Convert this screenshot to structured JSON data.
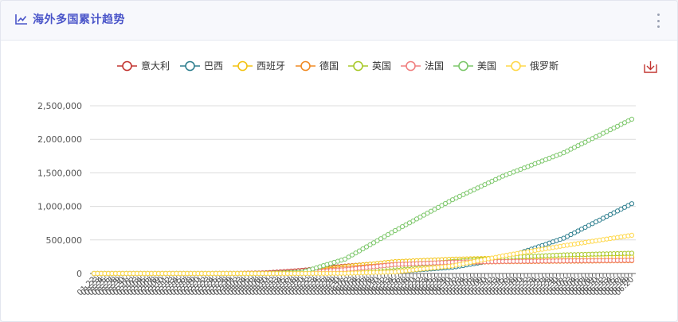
{
  "header": {
    "title": "海外多国累计趋势",
    "title_icon": "line-chart-icon",
    "menu_icon": "more-vertical-icon"
  },
  "toolbar": {
    "download_icon": "download-icon",
    "download_color": "#c23531"
  },
  "chart_data": {
    "type": "line",
    "title": "",
    "xlabel": "",
    "ylabel": "",
    "ylim": [
      0,
      2500000
    ],
    "yticks": [
      0,
      500000,
      1000000,
      1500000,
      2000000,
      2500000
    ],
    "ytick_labels": [
      "0",
      "500,000",
      "1,000,000",
      "1,500,000",
      "2,000,000",
      "2,500,000"
    ],
    "grid": true,
    "legend_position": "top",
    "marker": "hollow-circle",
    "x_start": "2020-01-22",
    "x_end": "2020-06-20",
    "x_tick_format": "MM.DD",
    "series": [
      {
        "name": "意大利",
        "color": "#c23531",
        "x": [
          "2020-01-22",
          "2020-02-21",
          "2020-03-01",
          "2020-03-10",
          "2020-03-20",
          "2020-04-01",
          "2020-04-15",
          "2020-05-01",
          "2020-05-15",
          "2020-06-01",
          "2020-06-20"
        ],
        "y": [
          0,
          20,
          1700,
          10100,
          47000,
          110000,
          165000,
          207000,
          224000,
          233000,
          238000
        ]
      },
      {
        "name": "巴西",
        "color": "#2f7f8f",
        "x": [
          "2020-01-22",
          "2020-03-01",
          "2020-03-20",
          "2020-04-01",
          "2020-04-15",
          "2020-05-01",
          "2020-05-15",
          "2020-06-01",
          "2020-06-20"
        ],
        "y": [
          0,
          2,
          900,
          6800,
          28000,
          92000,
          218000,
          526000,
          1040000
        ]
      },
      {
        "name": "西班牙",
        "color": "#f3c314",
        "x": [
          "2020-01-22",
          "2020-03-01",
          "2020-03-10",
          "2020-03-20",
          "2020-04-01",
          "2020-04-15",
          "2020-05-01",
          "2020-05-15",
          "2020-06-01",
          "2020-06-20"
        ],
        "y": [
          0,
          80,
          1700,
          21000,
          102000,
          177000,
          213000,
          230000,
          240000,
          246000
        ]
      },
      {
        "name": "德国",
        "color": "#f08a24",
        "x": [
          "2020-01-22",
          "2020-03-01",
          "2020-03-10",
          "2020-03-20",
          "2020-04-01",
          "2020-04-15",
          "2020-05-01",
          "2020-05-15",
          "2020-06-01",
          "2020-06-20"
        ],
        "y": [
          0,
          130,
          1500,
          19800,
          77000,
          134000,
          163000,
          175000,
          182000,
          190000
        ]
      },
      {
        "name": "英国",
        "color": "#a8c92a",
        "x": [
          "2020-01-22",
          "2020-03-01",
          "2020-03-10",
          "2020-03-20",
          "2020-04-01",
          "2020-04-15",
          "2020-05-01",
          "2020-05-15",
          "2020-06-01",
          "2020-06-20"
        ],
        "y": [
          0,
          36,
          380,
          4000,
          30000,
          99000,
          178000,
          237000,
          277000,
          302000
        ]
      },
      {
        "name": "法国",
        "color": "#f08080",
        "x": [
          "2020-01-22",
          "2020-03-01",
          "2020-03-10",
          "2020-03-20",
          "2020-04-01",
          "2020-04-15",
          "2020-05-01",
          "2020-05-15",
          "2020-06-01",
          "2020-06-20"
        ],
        "y": [
          0,
          130,
          1800,
          12600,
          57000,
          134000,
          168000,
          180000,
          189000,
          197000
        ]
      },
      {
        "name": "美国",
        "color": "#7cc76a",
        "x": [
          "2020-01-22",
          "2020-03-01",
          "2020-03-10",
          "2020-03-20",
          "2020-04-01",
          "2020-04-15",
          "2020-05-01",
          "2020-05-15",
          "2020-06-01",
          "2020-06-20"
        ],
        "y": [
          1,
          75,
          960,
          19000,
          215000,
          640000,
          1100000,
          1450000,
          1800000,
          2300000
        ]
      },
      {
        "name": "俄罗斯",
        "color": "#ffd84a",
        "x": [
          "2020-01-22",
          "2020-03-20",
          "2020-04-01",
          "2020-04-15",
          "2020-05-01",
          "2020-05-15",
          "2020-06-01",
          "2020-06-20"
        ],
        "y": [
          0,
          250,
          2800,
          24000,
          114000,
          262000,
          414000,
          570000
        ]
      }
    ]
  }
}
